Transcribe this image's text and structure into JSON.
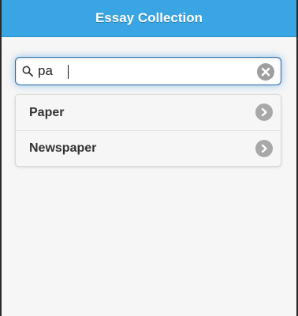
{
  "header": {
    "title": "Essay Collection"
  },
  "search": {
    "value": "pa",
    "clear_icon": "clear-icon",
    "icon": "search-icon"
  },
  "results": [
    {
      "label": "Paper",
      "icon": "chevron-right-icon"
    },
    {
      "label": "Newspaper",
      "icon": "chevron-right-icon"
    }
  ],
  "colors": {
    "header_bg": "#39a5e2",
    "focus_glow": "#3896e2",
    "page_bg": "#f6f6f6"
  }
}
